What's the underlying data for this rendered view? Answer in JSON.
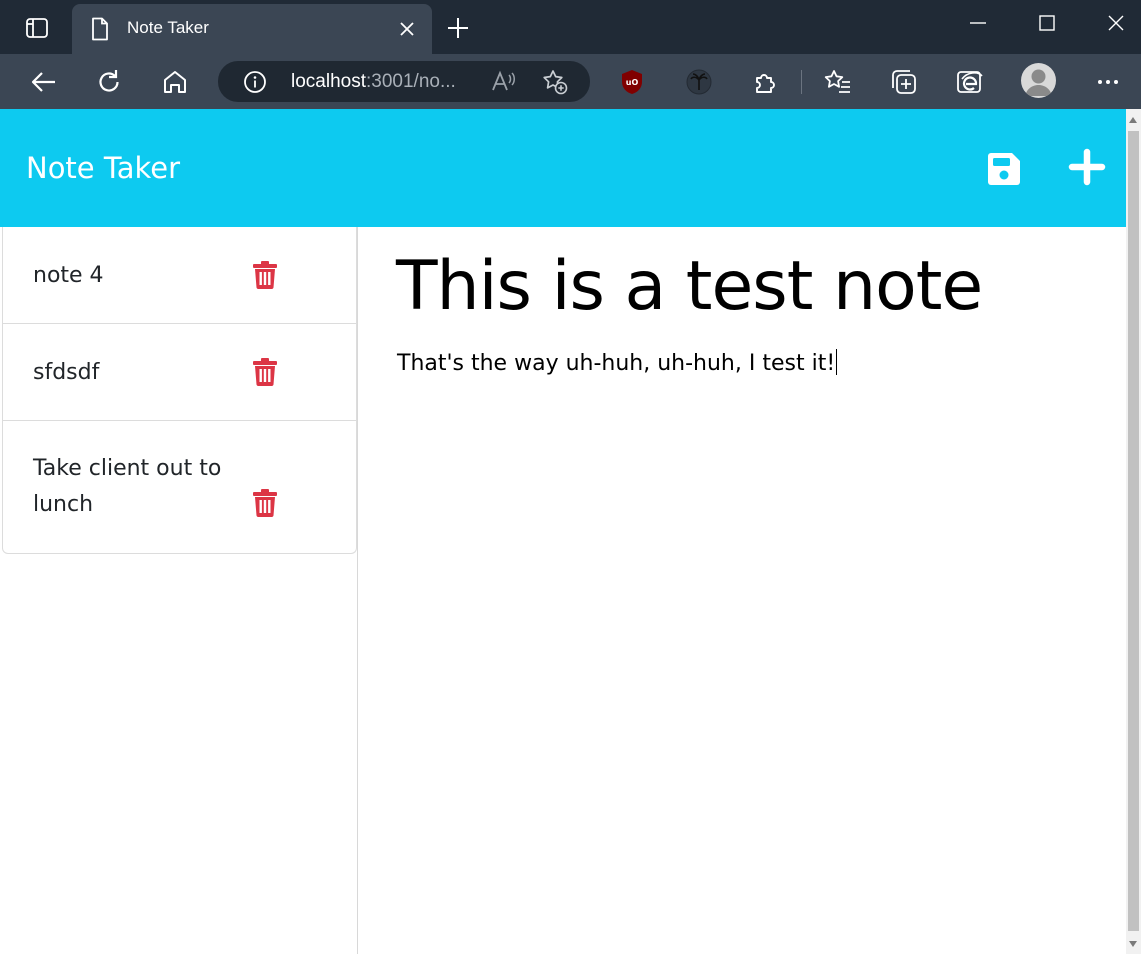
{
  "browser": {
    "tab_title": "Note Taker",
    "address": {
      "host": "localhost",
      "rest": ":3001/no..."
    }
  },
  "app": {
    "brand": "Note Taker",
    "header_color": "#0dcaf0",
    "icons": [
      "save-icon",
      "plus-icon",
      "trash-icon"
    ]
  },
  "notes": [
    {
      "title": "note 4"
    },
    {
      "title": "sfdsdf"
    },
    {
      "title": "Take client out to lunch"
    }
  ],
  "active_note": {
    "title": "This is a test note",
    "body": "That's the way uh-huh, uh-huh, I test it!"
  },
  "colors": {
    "trash": "#dc3545"
  }
}
